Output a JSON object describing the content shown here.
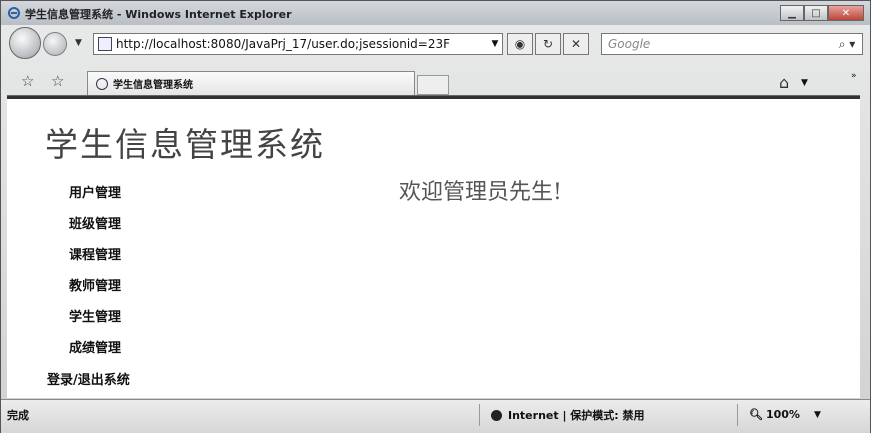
{
  "window": {
    "title": "学生信息管理系统 - Windows Internet Explorer"
  },
  "address": {
    "url": "http://localhost:8080/JavaPrj_17/user.do;jsessionid=23F"
  },
  "search": {
    "placeholder": "Google"
  },
  "tab": {
    "label": "学生信息管理系统"
  },
  "page": {
    "app_title": "学生信息管理系统",
    "welcome": "欢迎管理员先生!",
    "menu": [
      "用户管理",
      "班级管理",
      "课程管理",
      "教师管理",
      "学生管理",
      "成绩管理",
      "登录/退出系统"
    ]
  },
  "status": {
    "text": "完成",
    "zone": "Internet | 保护模式: 禁用",
    "zoom": "100%"
  }
}
